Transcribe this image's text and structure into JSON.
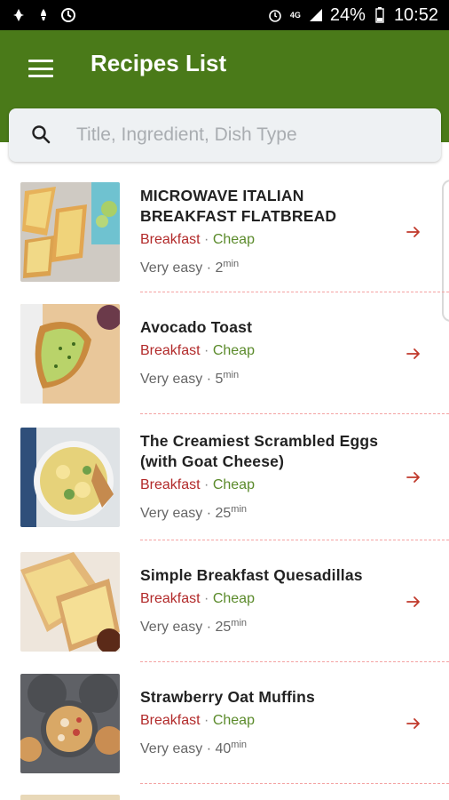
{
  "status": {
    "battery": "24%",
    "time": "10:52",
    "network_label": "4G"
  },
  "header": {
    "title": "Recipes List"
  },
  "search": {
    "placeholder": "Title, Ingredient, Dish Type",
    "value": ""
  },
  "recipes": [
    {
      "title": "MICROWAVE ITALIAN BREAKFAST FLATBREAD",
      "category": "Breakfast",
      "sep": " · ",
      "price": "Cheap",
      "difficulty": "Very easy · ",
      "time": "2",
      "unit": "min"
    },
    {
      "title": "Avocado Toast",
      "category": "Breakfast",
      "sep": " · ",
      "price": "Cheap",
      "difficulty": "Very easy · ",
      "time": "5",
      "unit": "min"
    },
    {
      "title": "The Creamiest Scrambled Eggs (with Goat Cheese)",
      "category": "Breakfast",
      "sep": " · ",
      "price": "Cheap",
      "difficulty": "Very easy · ",
      "time": "25",
      "unit": "min"
    },
    {
      "title": "Simple Breakfast Quesadillas",
      "category": "Breakfast",
      "sep": " · ",
      "price": "Cheap",
      "difficulty": "Very easy · ",
      "time": "25",
      "unit": "min"
    },
    {
      "title": "Strawberry Oat Muffins",
      "category": "Breakfast",
      "sep": " · ",
      "price": "Cheap",
      "difficulty": "Very easy · ",
      "time": "40",
      "unit": "min"
    }
  ]
}
